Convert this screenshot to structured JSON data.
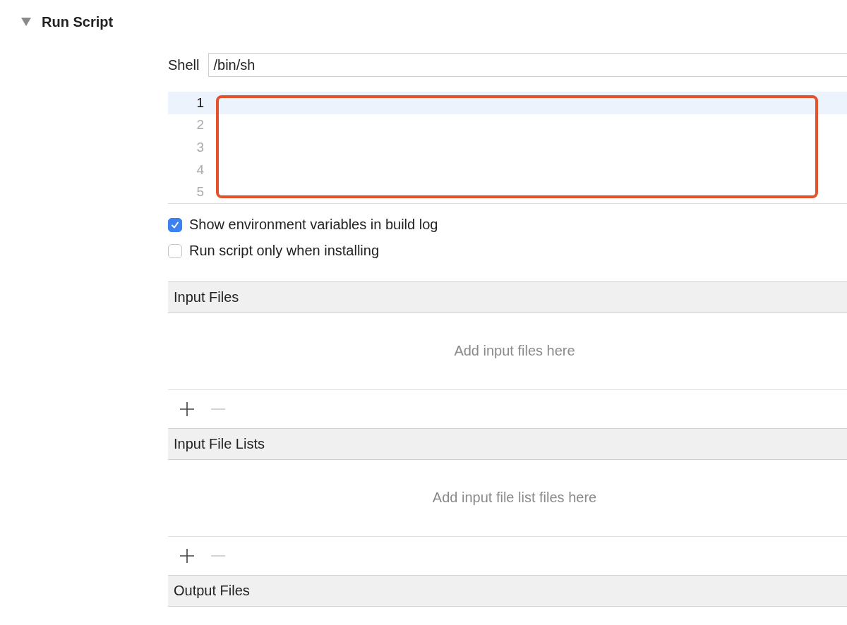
{
  "phase": {
    "title": "Run Script",
    "expanded": true
  },
  "shell": {
    "label": "Shell",
    "value": "/bin/sh"
  },
  "editor": {
    "lines": [
      {
        "number": "1",
        "selected": true
      },
      {
        "number": "2",
        "selected": false
      },
      {
        "number": "3",
        "selected": false
      },
      {
        "number": "4",
        "selected": false
      },
      {
        "number": "5",
        "selected": false
      }
    ],
    "highlighted": true
  },
  "options": [
    {
      "label": "Show environment variables in build log",
      "checked": true
    },
    {
      "label": "Run script only when installing",
      "checked": false
    }
  ],
  "sections": [
    {
      "title": "Input Files",
      "placeholder": "Add input files here",
      "add_disabled": false,
      "remove_disabled": true
    },
    {
      "title": "Input File Lists",
      "placeholder": "Add input file list files here",
      "add_disabled": false,
      "remove_disabled": true
    },
    {
      "title": "Output Files"
    }
  ]
}
